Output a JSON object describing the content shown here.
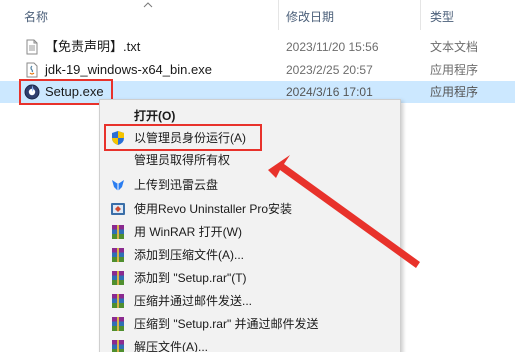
{
  "columns": {
    "name": "名称",
    "date": "修改日期",
    "type": "类型"
  },
  "files": [
    {
      "name": "【免责声明】.txt",
      "date": "2023/11/20 15:56",
      "type": "文本文档",
      "icon": "text-file-icon"
    },
    {
      "name": "jdk-19_windows-x64_bin.exe",
      "date": "2023/2/25 20:57",
      "type": "应用程序",
      "icon": "java-installer-icon"
    },
    {
      "name": "Setup.exe",
      "date": "2024/3/16 17:01",
      "type": "应用程序",
      "icon": "setup-exe-icon"
    }
  ],
  "context_menu": {
    "items": [
      {
        "label": "打开(O)",
        "icon": "",
        "bold": true
      },
      {
        "label": "以管理员身份运行(A)",
        "icon": "uac-shield-icon"
      },
      {
        "label": "管理员取得所有权",
        "icon": ""
      },
      {
        "label": "上传到迅雷云盘",
        "icon": "xunlei-bird-icon"
      },
      {
        "label": "使用Revo Uninstaller Pro安装",
        "icon": "revo-uninstaller-icon"
      },
      {
        "label": "用 WinRAR 打开(W)",
        "icon": "winrar-icon"
      },
      {
        "label": "添加到压缩文件(A)...",
        "icon": "winrar-icon"
      },
      {
        "label": "添加到 \"Setup.rar\"(T)",
        "icon": "winrar-icon"
      },
      {
        "label": "压缩并通过邮件发送...",
        "icon": "winrar-icon"
      },
      {
        "label": "压缩到 \"Setup.rar\" 并通过邮件发送",
        "icon": "winrar-icon"
      },
      {
        "label": "解压文件(A)...",
        "icon": "winrar-icon"
      }
    ]
  },
  "colors": {
    "selection": "#cce8ff",
    "highlight_box": "#e8322b",
    "menu_bg": "#f2f2f2",
    "header_text": "#4c607a"
  }
}
